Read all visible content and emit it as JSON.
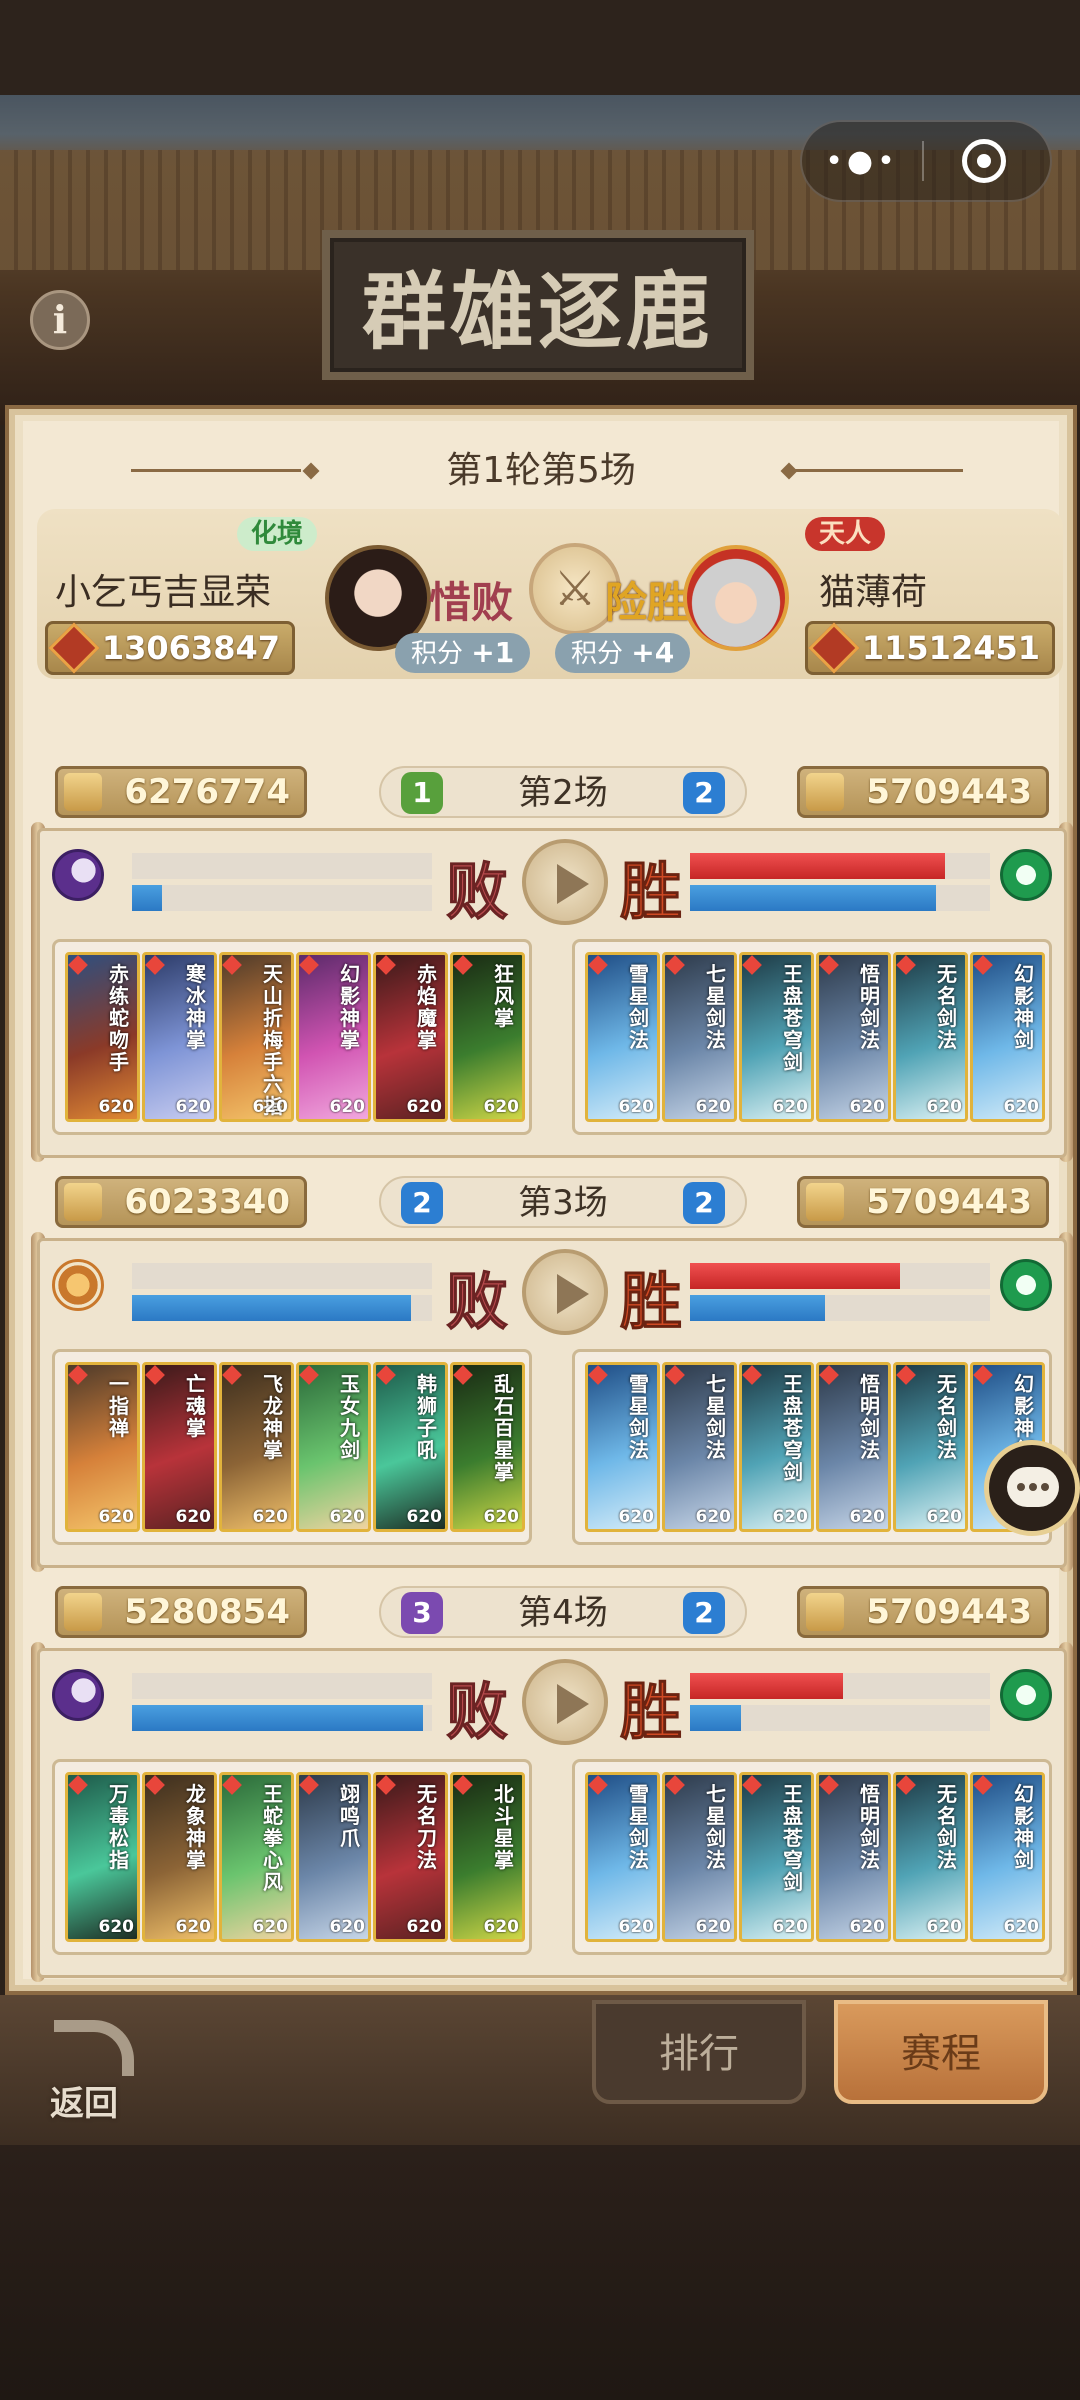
{
  "window": {
    "title": "群雄逐鹿"
  },
  "header": {
    "round": "第1轮第5场",
    "info_symbol": "i"
  },
  "left_player": {
    "name": "小乞丐吉显荣",
    "tier": "化境",
    "result": "惜败",
    "points_label": "积分",
    "points_value": "+1",
    "power": "13063847"
  },
  "right_player": {
    "name": "猫薄荷",
    "tier": "天人",
    "result": "险胜",
    "points_label": "积分",
    "points_value": "+4",
    "power": "11512451"
  },
  "matches": [
    {
      "title": "第2场",
      "left_gem": "1",
      "right_gem": "2",
      "left_power": "6276774",
      "right_power": "5709443",
      "left_result": "败",
      "right_result": "胜",
      "left_bars": [
        0.0,
        0.1
      ],
      "right_bars": [
        0.85,
        0.82
      ],
      "left_cards": [
        {
          "name": "赤练蛇吻手",
          "level": "620"
        },
        {
          "name": "寒冰神掌",
          "level": "620"
        },
        {
          "name": "天山折梅手六指",
          "level": "620"
        },
        {
          "name": "幻影神掌",
          "level": "620"
        },
        {
          "name": "赤焰魔掌",
          "level": "620"
        },
        {
          "name": "狂风掌",
          "level": "620"
        }
      ],
      "right_cards": [
        {
          "name": "雪星剑法",
          "level": "620"
        },
        {
          "name": "七星剑法",
          "level": "620"
        },
        {
          "name": "王盘苍穹剑",
          "level": "620"
        },
        {
          "name": "悟明剑法",
          "level": "620"
        },
        {
          "name": "无名剑法",
          "level": "620"
        },
        {
          "name": "幻影神剑",
          "level": "620"
        }
      ]
    },
    {
      "title": "第3场",
      "left_gem": "2",
      "right_gem": "2",
      "left_power": "6023340",
      "right_power": "5709443",
      "left_result": "败",
      "right_result": "胜",
      "left_bars": [
        0.0,
        0.93
      ],
      "right_bars": [
        0.7,
        0.45
      ],
      "left_cards": [
        {
          "name": "一指禅",
          "level": "620"
        },
        {
          "name": "亡魂掌",
          "level": "620"
        },
        {
          "name": "飞龙神掌",
          "level": "620"
        },
        {
          "name": "玉女九剑",
          "level": "620"
        },
        {
          "name": "韩狮子吼",
          "level": "620"
        },
        {
          "name": "乱石百星掌",
          "level": "620"
        }
      ],
      "right_cards": [
        {
          "name": "雪星剑法",
          "level": "620"
        },
        {
          "name": "七星剑法",
          "level": "620"
        },
        {
          "name": "王盘苍穹剑",
          "level": "620"
        },
        {
          "name": "悟明剑法",
          "level": "620"
        },
        {
          "name": "无名剑法",
          "level": "620"
        },
        {
          "name": "幻影神剑",
          "level": "620"
        }
      ]
    },
    {
      "title": "第4场",
      "left_gem": "3",
      "right_gem": "2",
      "left_power": "5280854",
      "right_power": "5709443",
      "left_result": "败",
      "right_result": "胜",
      "left_bars": [
        0.0,
        0.97
      ],
      "right_bars": [
        0.51,
        0.17
      ],
      "left_cards": [
        {
          "name": "万毒松指",
          "level": "620"
        },
        {
          "name": "龙象神掌",
          "level": "620"
        },
        {
          "name": "王蛇拳心风",
          "level": "620"
        },
        {
          "name": "翊鸣爪",
          "level": "620"
        },
        {
          "name": "无名刀法",
          "level": "620"
        },
        {
          "name": "北斗星掌",
          "level": "620"
        }
      ],
      "right_cards": [
        {
          "name": "雪星剑法",
          "level": "620"
        },
        {
          "name": "七星剑法",
          "level": "620"
        },
        {
          "name": "王盘苍穹剑",
          "level": "620"
        },
        {
          "name": "悟明剑法",
          "level": "620"
        },
        {
          "name": "无名剑法",
          "level": "620"
        },
        {
          "name": "幻影神剑",
          "level": "620"
        }
      ]
    }
  ],
  "bottom": {
    "back": "返回",
    "rank": "排行",
    "schedule": "赛程"
  },
  "colors": {
    "panel": "#ecdfc4",
    "lose": "#a13f4f",
    "win": "#d14a24",
    "bar_red": "#c62626",
    "bar_blue": "#2b79c4"
  }
}
